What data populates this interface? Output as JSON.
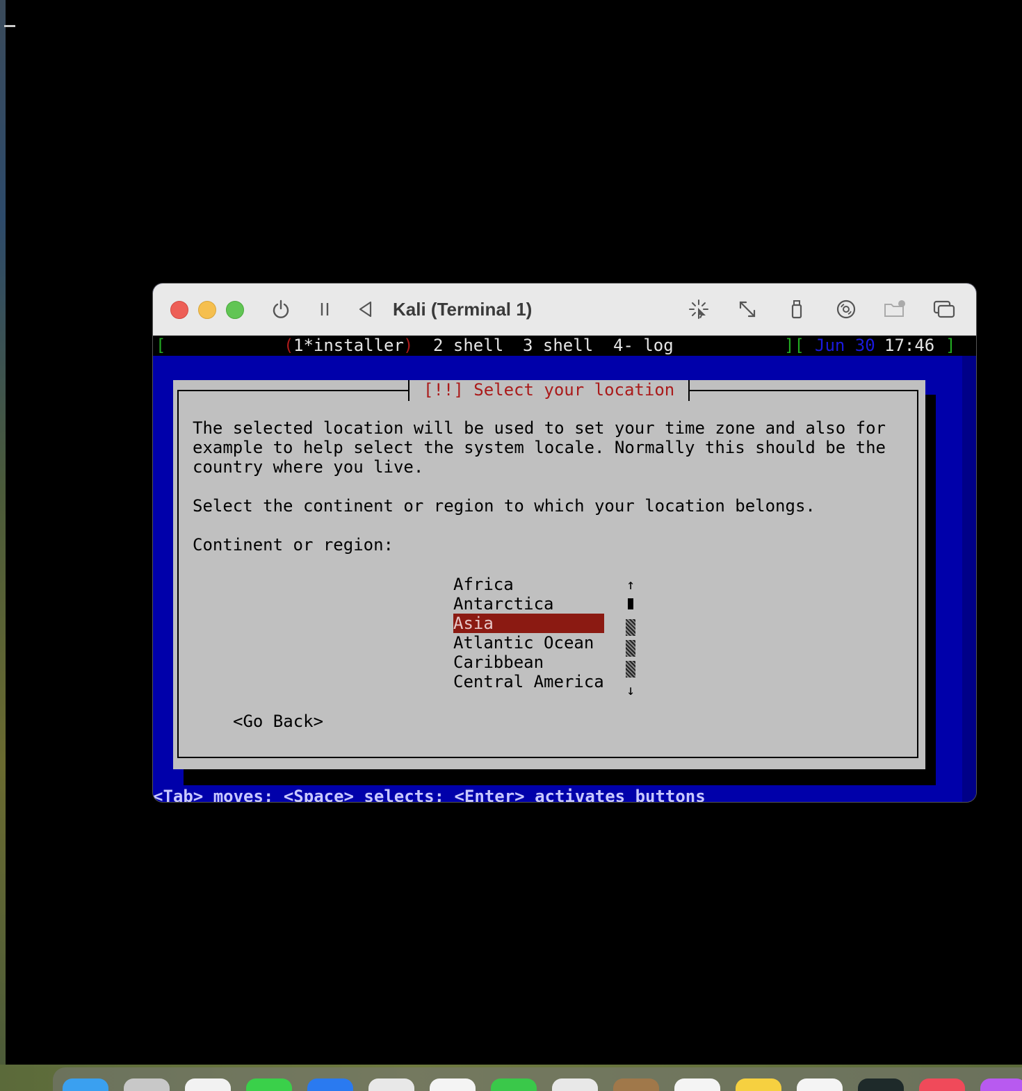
{
  "window": {
    "title": "Kali (Terminal 1)"
  },
  "tmux": {
    "left_bracket": "[",
    "paren_open": "(",
    "window1": "1*installer",
    "paren_close": ")",
    "window2": "2 shell",
    "window3": "3 shell",
    "window4": "4- log",
    "right_brackets": "][",
    "date": "Jun 30",
    "time": "17:46",
    "end_bracket": "]"
  },
  "dialog": {
    "title": "[!!] Select your location",
    "description_lines": [
      "The selected location will be used to set your time zone and also for",
      "example to help select the system locale. Normally this should be the",
      "country where you live."
    ],
    "instruction": "Select the continent or region to which your location belongs.",
    "list_label": "Continent or region:",
    "regions": [
      "Africa",
      "Antarctica",
      "Asia",
      "Atlantic Ocean",
      "Caribbean",
      "Central America"
    ],
    "selected_region": "Asia",
    "scroll_up": "↑",
    "scroll_down": "↓",
    "go_back": "<Go Back>"
  },
  "help_line": "<Tab> moves; <Space> selects; <Enter> activates buttons",
  "colors": {
    "terminal_bg": "#0000aa",
    "dialog_bg": "#c0c0c0",
    "selected_bg": "#8b1a12",
    "title_red": "#aa1a1a"
  }
}
